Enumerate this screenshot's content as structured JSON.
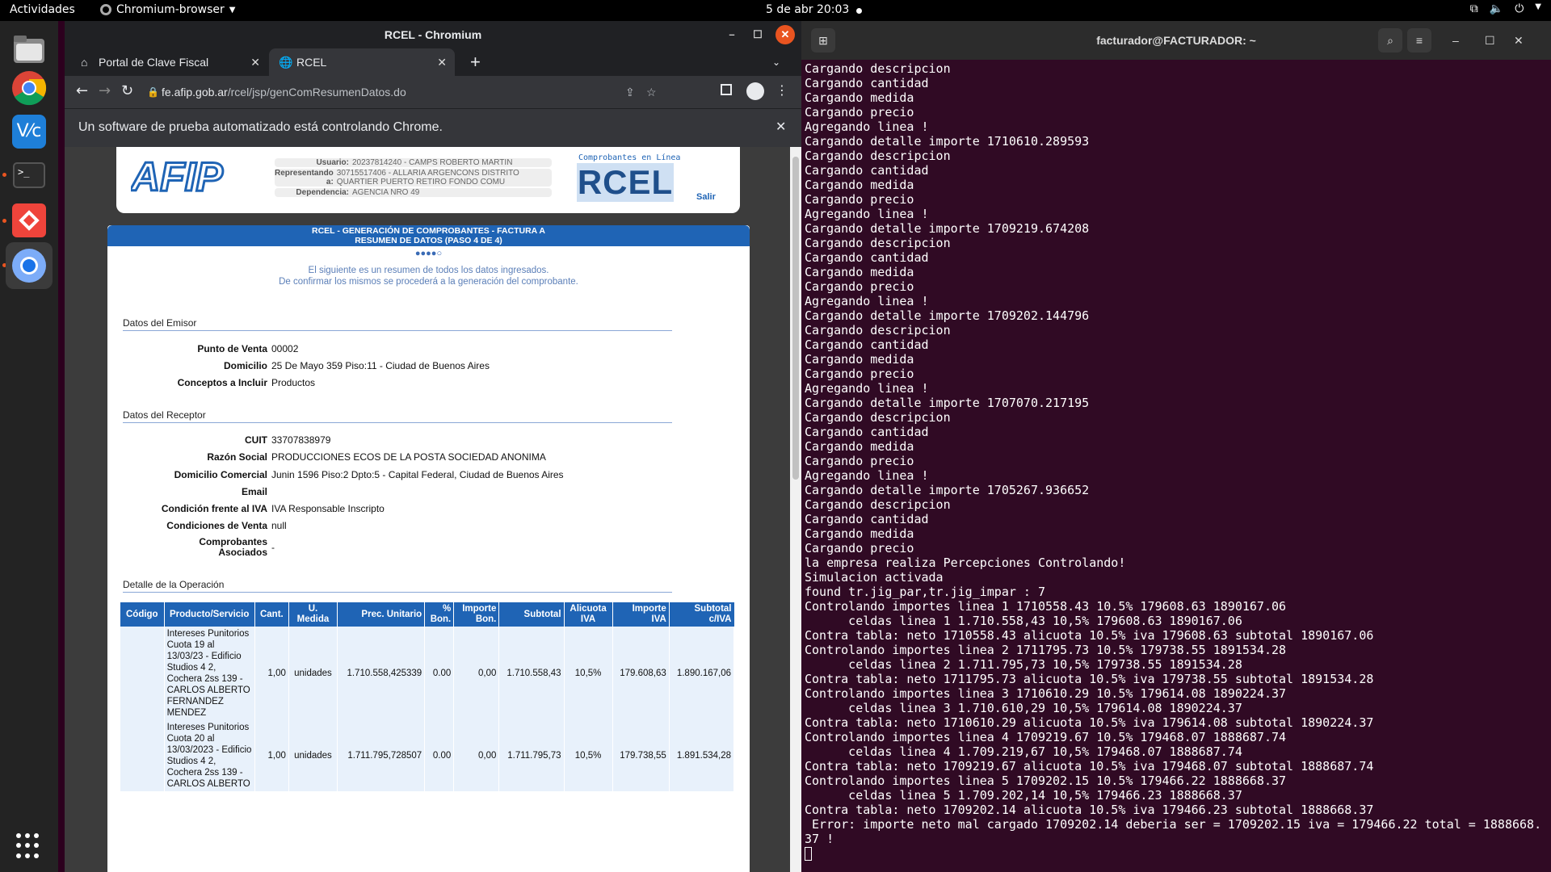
{
  "topbar": {
    "activities": "Actividades",
    "app_name": "Chromium-browser",
    "clock": "5 de abr  20:03"
  },
  "chrome": {
    "window_title": "RCEL - Chromium",
    "tabs": [
      {
        "label": "Portal de Clave Fiscal"
      },
      {
        "label": "RCEL"
      }
    ],
    "url_host": "fe.afip.gob.ar",
    "url_path": "/rcel/jsp/genComResumenDatos.do",
    "infobar": "Un software de prueba automatizado está controlando Chrome."
  },
  "page": {
    "header": {
      "logo_text": "AFIP",
      "usuario_label": "Usuario:",
      "usuario": "20237814240 - CAMPS ROBERTO MARTIN",
      "repr_label": "Representando a:",
      "repr": "30715517406 - ALLARIA ARGENCONS DISTRITO QUARTIER PUERTO RETIRO FONDO COMU",
      "dep_label": "Dependencia:",
      "dep": "AGENCIA NRO 49",
      "rcel_caption": "Comprobantes en Línea",
      "rcel_logo": "RCEL",
      "salir": "Salir"
    },
    "title1": "RCEL - GENERACIÓN DE COMPROBANTES - FACTURA A",
    "title2": "RESUMEN DE DATOS (PASO 4 DE 4)",
    "steps": "●●●●○",
    "intro1": "El siguiente es un resumen de todos los datos ingresados.",
    "intro2": "De confirmar los mismos se procederá a la generación del comprobante.",
    "emisor": {
      "section": "Datos del Emisor",
      "rows": [
        {
          "k": "Punto de Venta",
          "v": "00002"
        },
        {
          "k": "Domicilio",
          "v": "25 De Mayo 359 Piso:11 - Ciudad de Buenos Aires"
        },
        {
          "k": "Conceptos a Incluir",
          "v": "Productos"
        }
      ]
    },
    "receptor": {
      "section": "Datos del Receptor",
      "rows": [
        {
          "k": "CUIT",
          "v": "33707838979"
        },
        {
          "k": "Razón Social",
          "v": "PRODUCCIONES ECOS DE LA POSTA SOCIEDAD ANONIMA"
        },
        {
          "k": "Domicilio Comercial",
          "v": "Junin 1596 Piso:2 Dpto:5 - Capital Federal, Ciudad de Buenos Aires"
        },
        {
          "k": "Email",
          "v": ""
        },
        {
          "k": "Condición frente al IVA",
          "v": "IVA Responsable Inscripto"
        },
        {
          "k": "Condiciones de Venta",
          "v": "null"
        },
        {
          "k": "Comprobantes Asociados",
          "v": "-"
        }
      ]
    },
    "detalle": {
      "section": "Detalle de la Operación",
      "headers": [
        "Código",
        "Producto/Servicio",
        "Cant.",
        "U. Medida",
        "Prec. Unitario",
        "% Bon.",
        "Importe Bon.",
        "Subtotal",
        "Alicuota IVA",
        "Importe IVA",
        "Subtotal c/IVA"
      ],
      "rows": [
        [
          "",
          "Intereses Punitorios Cuota 19 al 13/03/23 - Edificio Studios 4 2, Cochera 2ss 139 - CARLOS ALBERTO FERNANDEZ MENDEZ",
          "1,00",
          "unidades",
          "1.710.558,425339",
          "0.00",
          "0,00",
          "1.710.558,43",
          "10,5%",
          "179.608,63",
          "1.890.167,06"
        ],
        [
          "",
          "Intereses Punitorios Cuota 20 al 13/03/2023 - Edificio Studios 4 2, Cochera 2ss 139 - CARLOS ALBERTO",
          "1,00",
          "unidades",
          "1.711.795,728507",
          "0.00",
          "0,00",
          "1.711.795,73",
          "10,5%",
          "179.738,55",
          "1.891.534,28"
        ]
      ]
    }
  },
  "terminal": {
    "title": "facturador@FACTURADOR: ~",
    "lines": [
      "Cargando descripcion",
      "Cargando cantidad",
      "Cargando medida",
      "Cargando precio",
      "Agregando linea !",
      "Cargando detalle importe 1710610.289593",
      "Cargando descripcion",
      "Cargando cantidad",
      "Cargando medida",
      "Cargando precio",
      "Agregando linea !",
      "Cargando detalle importe 1709219.674208",
      "Cargando descripcion",
      "Cargando cantidad",
      "Cargando medida",
      "Cargando precio",
      "Agregando linea !",
      "Cargando detalle importe 1709202.144796",
      "Cargando descripcion",
      "Cargando cantidad",
      "Cargando medida",
      "Cargando precio",
      "Agregando linea !",
      "Cargando detalle importe 1707070.217195",
      "Cargando descripcion",
      "Cargando cantidad",
      "Cargando medida",
      "Cargando precio",
      "Agregando linea !",
      "Cargando detalle importe 1705267.936652",
      "Cargando descripcion",
      "Cargando cantidad",
      "Cargando medida",
      "Cargando precio",
      "la empresa realiza Percepciones Controlando!",
      "Simulacion activada",
      "found tr.jig_par,tr.jig_impar : 7",
      "Controlando importes linea 1 1710558.43 10.5% 179608.63 1890167.06",
      "      celdas linea 1 1.710.558,43 10,5% 179608.63 1890167.06",
      "Contra tabla: neto 1710558.43 alicuota 10.5% iva 179608.63 subtotal 1890167.06",
      "Controlando importes linea 2 1711795.73 10.5% 179738.55 1891534.28",
      "      celdas linea 2 1.711.795,73 10,5% 179738.55 1891534.28",
      "Contra tabla: neto 1711795.73 alicuota 10.5% iva 179738.55 subtotal 1891534.28",
      "Controlando importes linea 3 1710610.29 10.5% 179614.08 1890224.37",
      "      celdas linea 3 1.710.610,29 10,5% 179614.08 1890224.37",
      "Contra tabla: neto 1710610.29 alicuota 10.5% iva 179614.08 subtotal 1890224.37",
      "Controlando importes linea 4 1709219.67 10.5% 179468.07 1888687.74",
      "      celdas linea 4 1.709.219,67 10,5% 179468.07 1888687.74",
      "Contra tabla: neto 1709219.67 alicuota 10.5% iva 179468.07 subtotal 1888687.74",
      "Controlando importes linea 5 1709202.15 10.5% 179466.22 1888668.37",
      "      celdas linea 5 1.709.202,14 10,5% 179466.23 1888668.37",
      "Contra tabla: neto 1709202.14 alicuota 10.5% iva 179466.23 subtotal 1888668.37",
      " Error: importe neto mal cargado 1709202.14 deberia ser = 1709202.15 iva = 179466.22 total = 1888668.",
      "37 !"
    ]
  }
}
